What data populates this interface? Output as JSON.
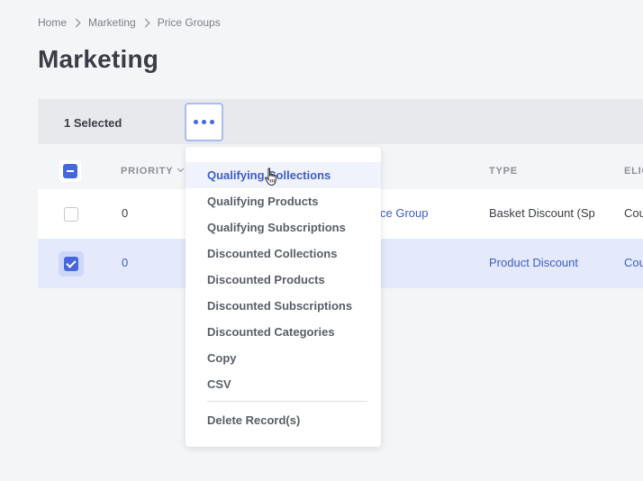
{
  "breadcrumb": [
    "Home",
    "Marketing",
    "Price Groups"
  ],
  "page_title": "Marketing",
  "toolbar": {
    "selected_label": "1 Selected"
  },
  "table": {
    "columns": {
      "priority": "PRIORITY",
      "type": "TYPE",
      "eligibility": "ELIG"
    },
    "rows": [
      {
        "priority": "0",
        "name": "ce Group",
        "type": "Basket Discount (Sp",
        "eligibility": "Cou",
        "checked": false
      },
      {
        "priority": "0",
        "name": "",
        "type": "Product Discount",
        "eligibility": "Cou",
        "checked": true
      }
    ]
  },
  "dropdown": {
    "items": [
      "Qualifying Collections",
      "Qualifying Products",
      "Qualifying Subscriptions",
      "Discounted Collections",
      "Discounted Products",
      "Discounted Subscriptions",
      "Discounted Categories",
      "Copy",
      "CSV",
      "Delete Record(s)"
    ]
  },
  "colors": {
    "accent": "#4668dc",
    "link": "#3e5cc7",
    "selected_row": "#e4eafb"
  }
}
